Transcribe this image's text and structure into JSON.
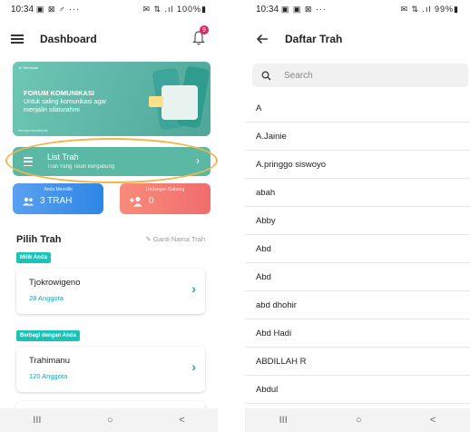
{
  "left": {
    "status": {
      "time": "10:34",
      "icons_left": "▣ ⊠ ♂ ···",
      "icons_right": "✉ ⇅ .ıl 100%▮"
    },
    "title": "Dashboard",
    "notif_count": "9",
    "banner": {
      "brand": "Jv Telmasak",
      "heading": "FORUM KOMUNIKASI",
      "subtitle": "Untuk saling komunikasi agar menjalin silaturahmi",
      "hashtag": "#familyconnectfamily"
    },
    "list_trah": {
      "label": "List Trah",
      "sub": "Trah Yang Telah Bergabung"
    },
    "stats": [
      {
        "label": "Anda Memiliki",
        "value": "3 TRAH"
      },
      {
        "label": "Undangan Gabung",
        "value": "0"
      }
    ],
    "section_title": "Pilih Trah",
    "rename_label": "Ganti Nama Trah",
    "owned_label": "Milik Anda",
    "shared_label": "Berbagi dengan Anda",
    "trah_owned": {
      "name": "Tjokrowigeno",
      "count": "28 Anggota"
    },
    "trah_shared": {
      "name": "Trahimanu",
      "count": "120 Anggota"
    }
  },
  "right": {
    "status": {
      "time": "10:34",
      "icons_left": "▣ ▣ ⊠ ···",
      "icons_right": "✉ ⇅ .ıl 99%▮"
    },
    "title": "Daftar Trah",
    "search_placeholder": "Search",
    "items": [
      "A",
      "A.Jainie",
      "A.pringgo siswoyo",
      "abah",
      "Abby",
      "Abd",
      "Abd",
      "abd dhohir",
      "Abd Hadi",
      "ABDILLAH R",
      "Abdul"
    ]
  },
  "navbar": {
    "recents": "III",
    "home": "○",
    "back": "<"
  },
  "colors": {
    "accent": "#16a6b8",
    "banner": "#5bb8a4",
    "highlight": "#f4b64a"
  }
}
